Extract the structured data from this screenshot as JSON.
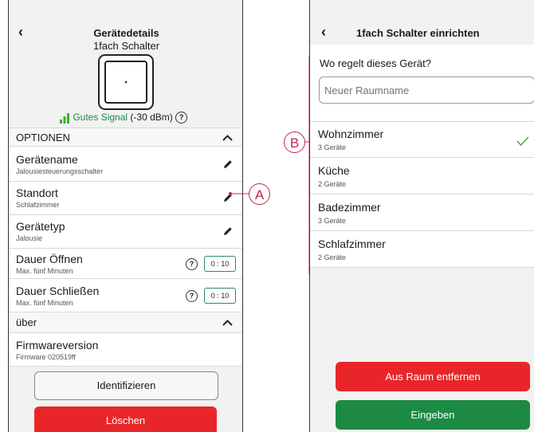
{
  "left": {
    "back": "‹",
    "title": "Gerätedetails",
    "subtitle": "1fach Schalter",
    "signal_label": "Gutes Signal",
    "signal_value": "(-30 dBm)",
    "help": "?",
    "options_header": "OPTIONEN",
    "rows": [
      {
        "label": "Gerätename",
        "sub": "Jalousiesteuerungsschalter"
      },
      {
        "label": "Standort",
        "sub": "Schlafzimmer"
      },
      {
        "label": "Gerätetyp",
        "sub": "Jalousie"
      }
    ],
    "timers": [
      {
        "label": "Dauer Öffnen",
        "sub": "Max. fünf Minuten",
        "value": "0 : 10"
      },
      {
        "label": "Dauer Schließen",
        "sub": "Max. fünf Minuten",
        "value": "0 : 10"
      }
    ],
    "about_header": "über",
    "firmware": {
      "label": "Firmwareversion",
      "sub": "Firmware 020519ff"
    },
    "identify_button": "Identifizieren",
    "delete_button": "Löschen"
  },
  "right": {
    "back": "‹",
    "title": "1fach Schalter einrichten",
    "question": "Wo regelt dieses Gerät?",
    "placeholder": "Neuer Raumname",
    "rooms": [
      {
        "name": "Wohnzimmer",
        "count": "3 Geräte",
        "selected": true
      },
      {
        "name": "Küche",
        "count": "2 Geräte",
        "selected": false
      },
      {
        "name": "Badezimmer",
        "count": "3 Geräte",
        "selected": false
      },
      {
        "name": "Schlafzimmer",
        "count": "2 Geräte",
        "selected": false
      }
    ],
    "remove_button": "Aus Raum entfernen",
    "submit_button": "Eingeben"
  },
  "callouts": {
    "a": "A",
    "b": "B"
  },
  "colors": {
    "green": "#1d8a44",
    "red": "#e8262a",
    "callout": "#c0294e",
    "signal": "#3dae2b"
  }
}
